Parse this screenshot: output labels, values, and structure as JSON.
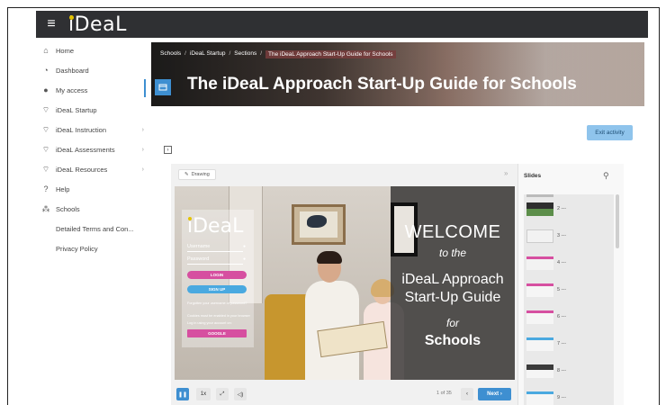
{
  "topbar": {
    "menu_icon": "hamburger-icon",
    "logo_text": "iDeaL"
  },
  "sidebar": {
    "items": [
      {
        "label": "Home",
        "icon": "home-icon",
        "caret": false
      },
      {
        "label": "Dashboard",
        "icon": "dashboard-icon",
        "caret": false
      },
      {
        "label": "My access",
        "icon": "user-icon",
        "caret": false
      },
      {
        "label": "iDeaL Startup",
        "icon": "graduation-cap-icon",
        "caret": false
      },
      {
        "label": "iDeaL Instruction",
        "icon": "graduation-cap-icon",
        "caret": true
      },
      {
        "label": "iDeaL Assessments",
        "icon": "graduation-cap-icon",
        "caret": true
      },
      {
        "label": "iDeaL Resources",
        "icon": "graduation-cap-icon",
        "caret": true
      },
      {
        "label": "Help",
        "icon": "help-icon",
        "caret": false
      },
      {
        "label": "Schools",
        "icon": "sitemap-icon",
        "caret": false
      },
      {
        "label": "Detailed Terms and Con...",
        "icon": "",
        "caret": false
      },
      {
        "label": "Privacy Policy",
        "icon": "",
        "caret": false
      }
    ]
  },
  "banner": {
    "breadcrumbs": [
      "Schools",
      "iDeaL Startup",
      "Sections",
      "The iDeaL Approach Start-Up Guide for Schools"
    ],
    "title": "The iDeaL Approach Start-Up Guide for Schools"
  },
  "exit_button": "Exit activity",
  "player": {
    "drawing_label": "Drawing",
    "slide": {
      "welcome": "WELCOME",
      "to_the": "to the",
      "ideal_line1": "iDeaL Approach",
      "ideal_line2": "Start-Up Guide",
      "for": "for",
      "schools": "Schools",
      "login_logo": "iDeaL",
      "username": "Username",
      "password": "Password",
      "login_btn": "LOGIN",
      "signup_btn": "SIGN UP",
      "forgot": "Forgotten your username or password?",
      "cookies": "Cookies must be enabled in your browser",
      "google_line": "Log in using your account on:",
      "google_btn": "GOOGLE"
    },
    "controls": {
      "speed": "1x",
      "counter": "1 of 35",
      "next": "Next"
    },
    "slides_panel": {
      "title": "Slides",
      "items": [
        "2 ---",
        "3 ---",
        "4 ---",
        "5 ---",
        "6 ---",
        "7 ---",
        "8 ---",
        "9 ---"
      ]
    }
  },
  "colors": {
    "topbar": "#2f3033",
    "accent_blue": "#3e8fd1",
    "login_pink": "#d64fa0",
    "signup_blue": "#4aa9e0",
    "exit_button": "#8fc4ec"
  }
}
